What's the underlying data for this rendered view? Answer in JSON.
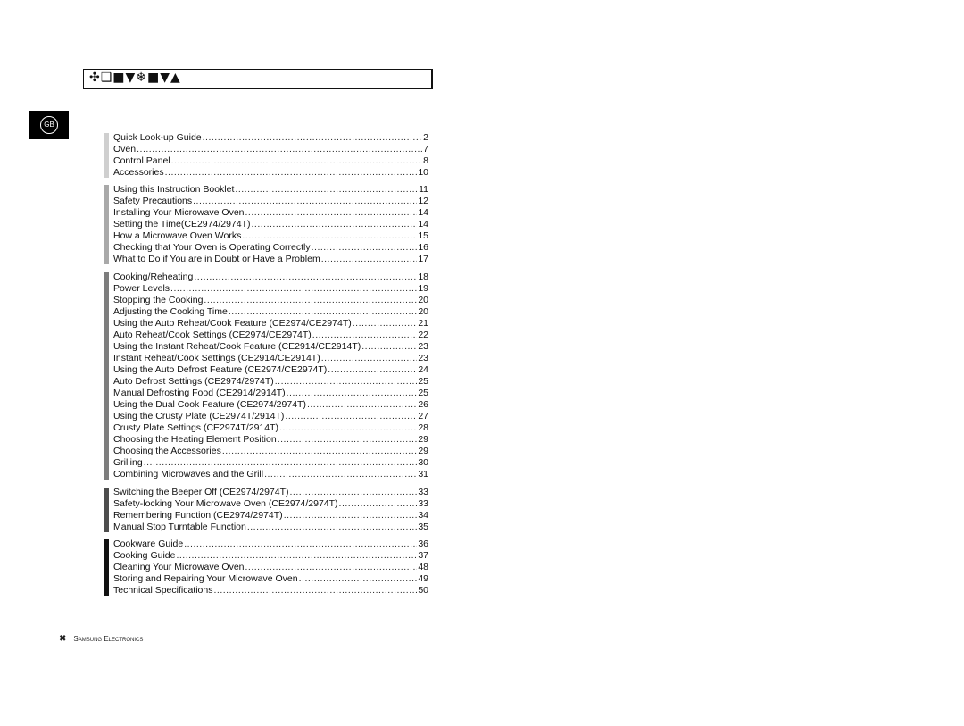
{
  "header": {
    "title_glyphs": "✣❑■▼❄■▼▲"
  },
  "language_badge": "GB",
  "toc": [
    {
      "color": "#cfcfcf",
      "items": [
        [
          "Quick Look-up Guide",
          "2"
        ],
        [
          "Oven",
          "7"
        ],
        [
          "Control Panel",
          "8"
        ],
        [
          "Accessories",
          "10"
        ]
      ]
    },
    {
      "color": "#a9a9a9",
      "items": [
        [
          "Using this Instruction Booklet",
          "11"
        ],
        [
          "Safety Precautions",
          "12"
        ],
        [
          "Installing Your Microwave Oven",
          "14"
        ],
        [
          "Setting the Time(CE2974/2974T)",
          "14"
        ],
        [
          "How a Microwave Oven Works",
          "15"
        ],
        [
          "Checking that Your Oven is Operating Correctly",
          "16"
        ],
        [
          "What to Do if You are in Doubt or Have a Problem",
          "17"
        ]
      ]
    },
    {
      "color": "#7d7d7d",
      "items": [
        [
          "Cooking/Reheating",
          "18"
        ],
        [
          "Power Levels",
          "19"
        ],
        [
          "Stopping the Cooking",
          "20"
        ],
        [
          "Adjusting the Cooking Time",
          "20"
        ],
        [
          "Using the Auto Reheat/Cook Feature (CE2974/CE2974T)",
          "21"
        ],
        [
          "Auto Reheat/Cook Settings (CE2974/CE2974T)",
          "22"
        ],
        [
          "Using the Instant Reheat/Cook Feature (CE2914/CE2914T)",
          "23"
        ],
        [
          "Instant Reheat/Cook Settings (CE2914/CE2914T)",
          "23"
        ],
        [
          "Using the Auto Defrost Feature (CE2974/CE2974T)",
          "24"
        ],
        [
          "Auto Defrost Settings (CE2974/2974T)",
          "25"
        ],
        [
          "Manual Defrosting Food (CE2914/2914T)",
          "25"
        ],
        [
          "Using the Dual Cook Feature (CE2974/2974T)",
          "26"
        ],
        [
          "Using the Crusty Plate (CE2974T/2914T)",
          "27"
        ],
        [
          "Crusty Plate Settings (CE2974T/2914T)",
          "28"
        ],
        [
          "Choosing the Heating Element Position",
          "29"
        ],
        [
          "Choosing the Accessories",
          "29"
        ],
        [
          "Grilling",
          "30"
        ],
        [
          "Combining Microwaves and the Grill",
          "31"
        ]
      ]
    },
    {
      "color": "#4d4d4d",
      "items": [
        [
          "Switching the Beeper Off (CE2974/2974T)",
          "33"
        ],
        [
          "Safety-locking Your Microwave Oven (CE2974/2974T)",
          "33"
        ],
        [
          "Remembering Function (CE2974/2974T)",
          "34"
        ],
        [
          "Manual Stop Turntable Function",
          "35"
        ]
      ]
    },
    {
      "color": "#111111",
      "items": [
        [
          "Cookware Guide",
          "36"
        ],
        [
          "Cooking Guide",
          "37"
        ],
        [
          "Cleaning Your Microwave Oven",
          "48"
        ],
        [
          "Storing and Repairing Your Microwave Oven",
          "49"
        ],
        [
          "Technical Specifications",
          "50"
        ]
      ]
    }
  ],
  "footer": {
    "icon": "page-marker-icon",
    "glyph": "✖",
    "s1": "S",
    "r1": "AMSUNG",
    "s2": "E",
    "r2": "LECTRONICS"
  }
}
